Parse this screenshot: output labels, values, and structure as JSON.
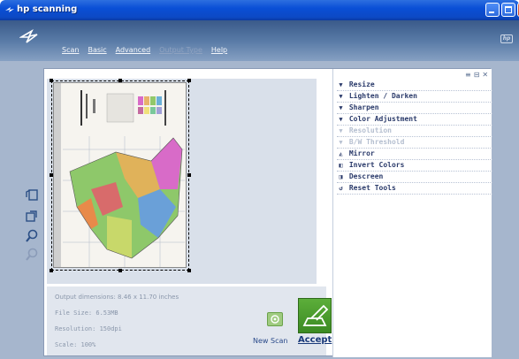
{
  "window": {
    "title": "hp scanning"
  },
  "menu": {
    "items": [
      {
        "label": "Scan",
        "enabled": true
      },
      {
        "label": "Basic",
        "enabled": true
      },
      {
        "label": "Advanced",
        "enabled": true
      },
      {
        "label": "Output Type",
        "enabled": false
      },
      {
        "label": "Help",
        "enabled": true
      }
    ]
  },
  "tools_panel": {
    "items": [
      {
        "label": "Resize",
        "icon": "triangle-down",
        "enabled": true
      },
      {
        "label": "Lighten / Darken",
        "icon": "triangle-down",
        "enabled": true
      },
      {
        "label": "Sharpen",
        "icon": "triangle-down",
        "enabled": true
      },
      {
        "label": "Color Adjustment",
        "icon": "triangle-down",
        "enabled": true
      },
      {
        "label": "Resolution",
        "icon": "triangle-down",
        "enabled": false
      },
      {
        "label": "B/W Threshold",
        "icon": "triangle-down",
        "enabled": false
      },
      {
        "label": "Mirror",
        "icon": "mirror-icon",
        "enabled": true
      },
      {
        "label": "Invert Colors",
        "icon": "invert-icon",
        "enabled": true
      },
      {
        "label": "Descreen",
        "icon": "descreen-icon",
        "enabled": true
      },
      {
        "label": "Reset Tools",
        "icon": "reset-icon",
        "enabled": true
      }
    ]
  },
  "info": {
    "output_dimensions": "Output dimensions: 8.46 x 11.70 inches",
    "file_size": "File Size: 6.53MB",
    "resolution": "Resolution: 150dpi",
    "scale": "Scale: 100%"
  },
  "actions": {
    "new_scan_label": "New Scan",
    "accept_label": "Accept"
  },
  "colors": {
    "titlebar": "#0a4fd6",
    "chrome": "#a6b6cd",
    "accept_green": "#4a9d2e"
  }
}
